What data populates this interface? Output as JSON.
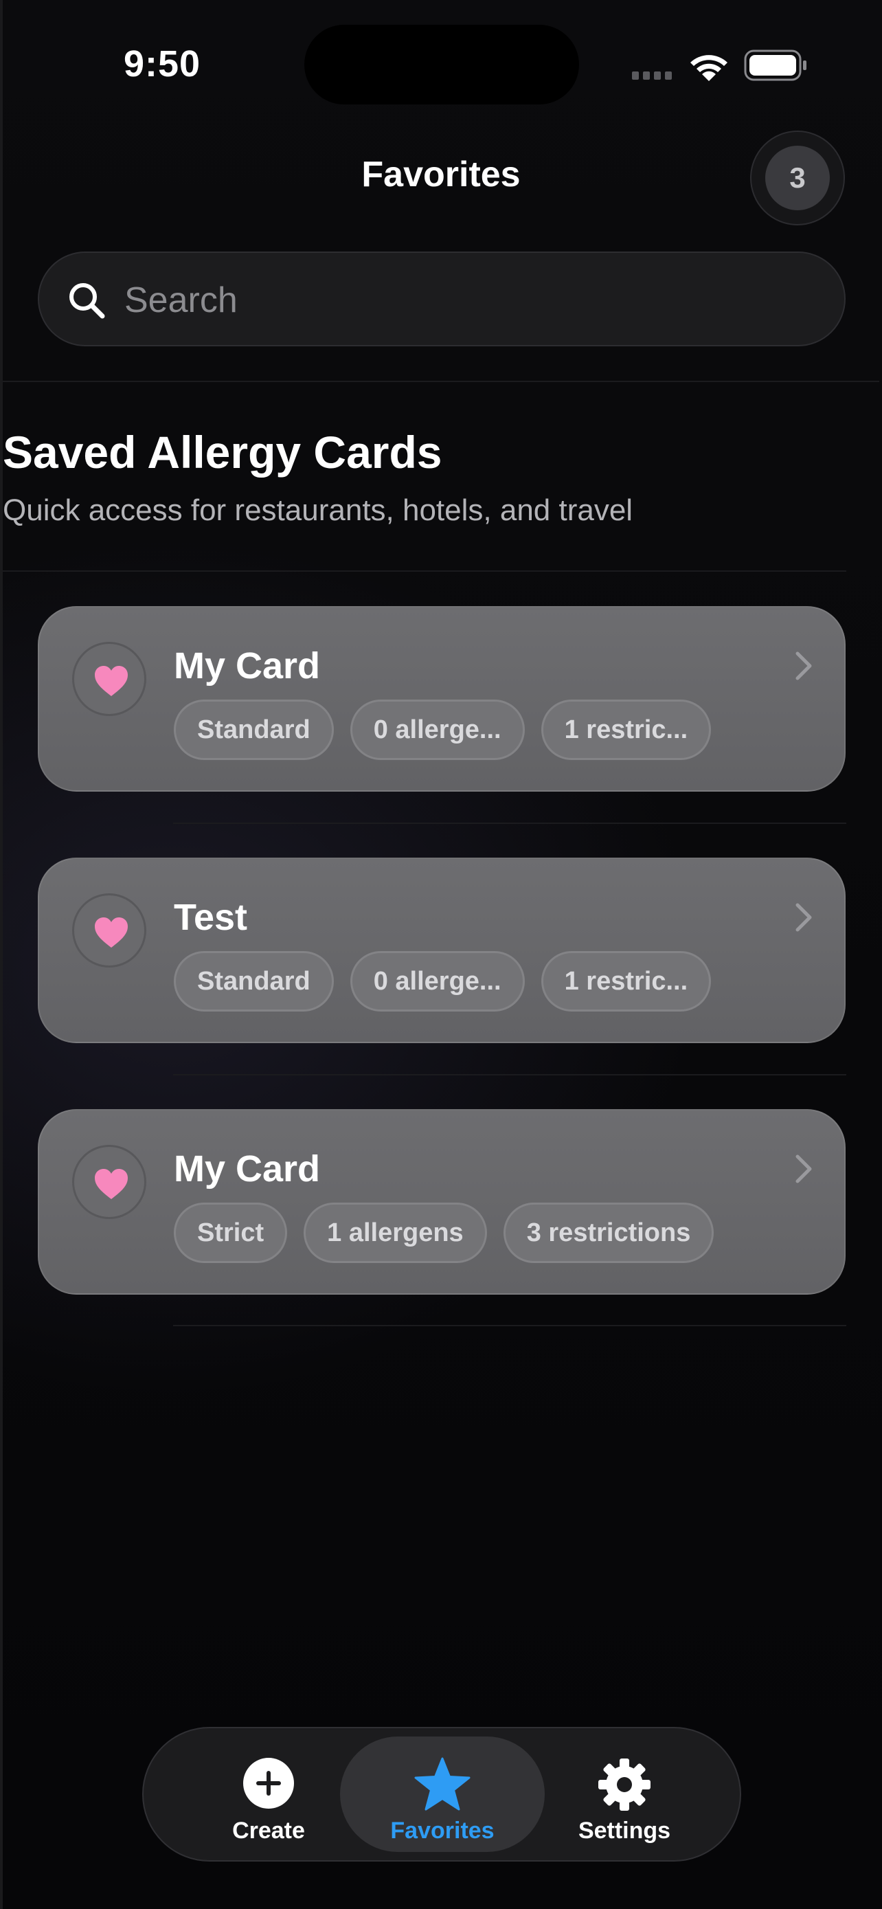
{
  "status_bar": {
    "time": "9:50"
  },
  "nav": {
    "title": "Favorites",
    "count": "3"
  },
  "search": {
    "placeholder": "Search",
    "value": ""
  },
  "section": {
    "title": "Saved Allergy Cards",
    "subtitle": "Quick access for restaurants, hotels, and travel"
  },
  "cards": [
    {
      "title": "My Card",
      "icon": "heart-icon",
      "chips": [
        "Standard",
        "0 allerge...",
        "1 restric..."
      ]
    },
    {
      "title": "Test",
      "icon": "heart-icon",
      "chips": [
        "Standard",
        "0 allerge...",
        "1 restric..."
      ]
    },
    {
      "title": "My Card",
      "icon": "heart-icon",
      "chips": [
        "Strict",
        "1 allergens",
        "3 restrictions"
      ]
    }
  ],
  "tab_bar": {
    "items": [
      {
        "label": "Create",
        "icon": "plus-circle-icon",
        "active": false
      },
      {
        "label": "Favorites",
        "icon": "star-icon",
        "active": true
      },
      {
        "label": "Settings",
        "icon": "gear-icon",
        "active": false
      }
    ]
  },
  "colors": {
    "background": "#070709",
    "accent": "#2e9cf4",
    "heart": "#f788bd",
    "card": "#6a6a6d"
  }
}
